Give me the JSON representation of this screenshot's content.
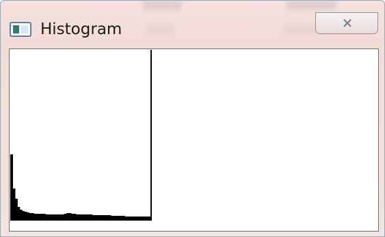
{
  "window": {
    "title": "Histogram",
    "app_icon": "window-app-icon",
    "close_icon": "close-icon",
    "close_glyph": "⨯",
    "colors": {
      "frame": "#f3dcd8",
      "canvas": "#ffffff",
      "histogram": "#000000"
    }
  },
  "histogram": {
    "bins": [
      95,
      45,
      30,
      18,
      14,
      12,
      11,
      10,
      9,
      9,
      8,
      8,
      8,
      8,
      8,
      7,
      7,
      7,
      7,
      7,
      7,
      7,
      7,
      8,
      9,
      9,
      8,
      8,
      7,
      7,
      7,
      7,
      7,
      7,
      7,
      6,
      6,
      6,
      6,
      6,
      6,
      6,
      6,
      5,
      5,
      5,
      5,
      5,
      5,
      4,
      4,
      4,
      4,
      4,
      4,
      4,
      4,
      4,
      4,
      4
    ]
  }
}
